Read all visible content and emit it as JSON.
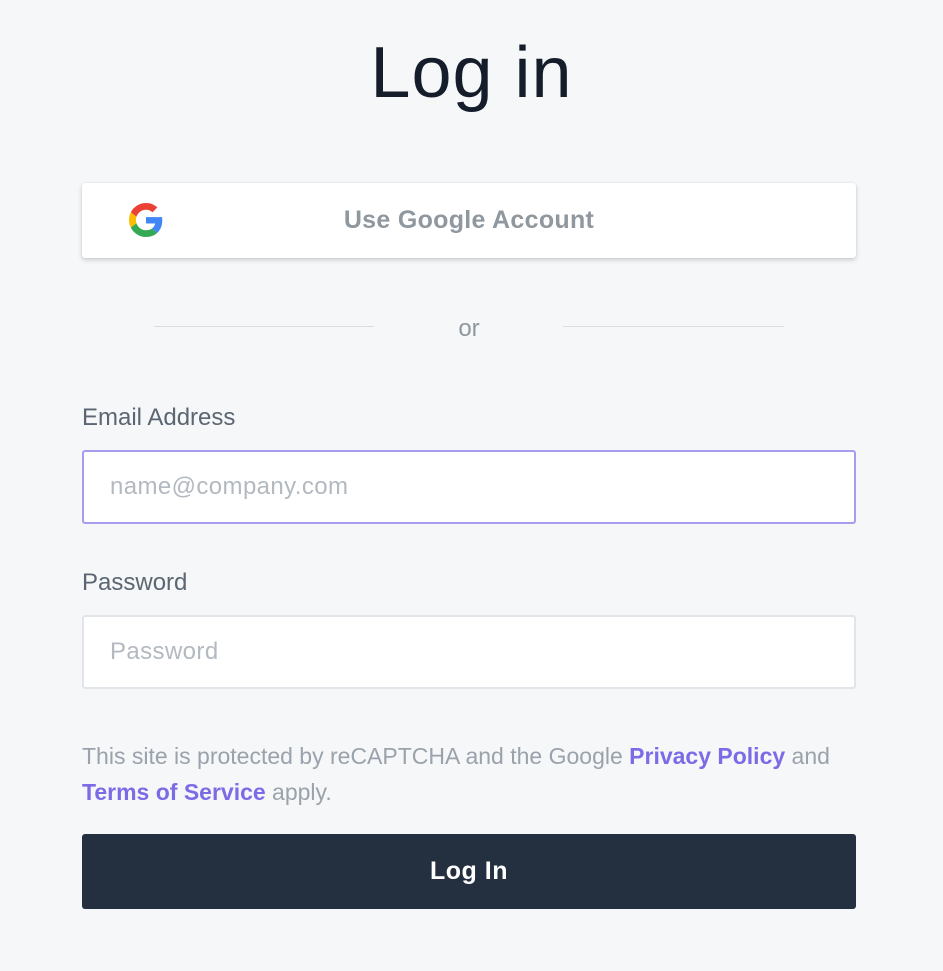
{
  "page": {
    "title": "Log in"
  },
  "google": {
    "label": "Use Google Account",
    "icon": "google-g-icon",
    "colors": {
      "blue": "#4285F4",
      "red": "#EA4335",
      "yellow": "#FBBC05",
      "green": "#34A853"
    }
  },
  "divider": {
    "text": "or"
  },
  "form": {
    "email": {
      "label": "Email Address",
      "placeholder": "name@company.com",
      "value": ""
    },
    "password": {
      "label": "Password",
      "placeholder": "Password",
      "value": ""
    },
    "legal": {
      "prefix": "This site is protected by reCAPTCHA and the Google ",
      "privacy_link": "Privacy Policy",
      "middle": " and ",
      "terms_link": "Terms of Service",
      "suffix": " apply."
    },
    "submit_label": "Log In"
  },
  "colors": {
    "background": "#f5f7f9",
    "primary_button": "#24303f",
    "link": "#7b6be6",
    "focus_border": "#a89cef"
  }
}
